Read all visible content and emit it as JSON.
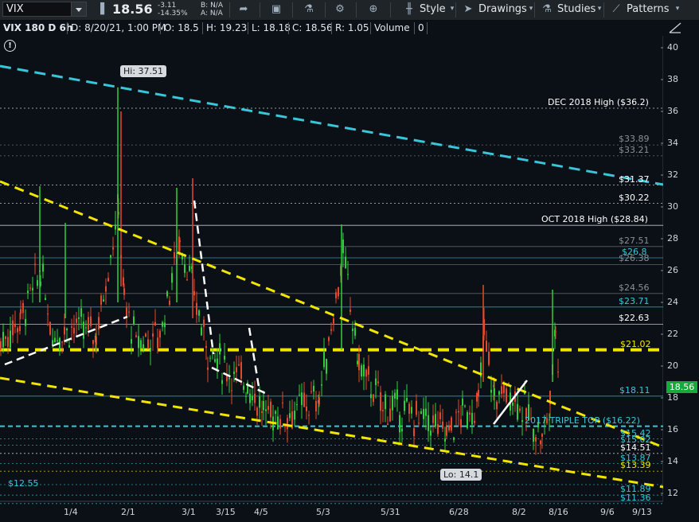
{
  "toolbar": {
    "symbol": "VIX",
    "last": "18.56",
    "change": "-3.11",
    "change_pct": "-14.35%",
    "bid": "B: N/A",
    "ask": "A: N/A",
    "style_label": "Style",
    "drawings_label": "Drawings",
    "studies_label": "Studies",
    "patterns_label": "Patterns"
  },
  "infobar": {
    "series": "VIX 180 D 6h",
    "date": "D: 8/20/21, 1:00 PM",
    "open": "O: 18.5",
    "high": "H: 19.23",
    "low": "L: 18.18",
    "close": "C: 18.56",
    "range": "R: 1.05",
    "volume_label": "Volume",
    "volume_value": "0"
  },
  "y_ticks": [
    "40",
    "38",
    "36",
    "34",
    "32",
    "30",
    "28",
    "26",
    "24",
    "22",
    "20",
    "18",
    "16",
    "14",
    "12"
  ],
  "x_ticks": [
    "1/4",
    "2/1",
    "3/1",
    "3/15",
    "4/5",
    "5/3",
    "5/31",
    "6/28",
    "8/2",
    "8/16",
    "9/6",
    "9/13"
  ],
  "levels": [
    {
      "text": "DEC 2018 High ($36.2)",
      "color": "#ffffff"
    },
    {
      "text": "$33.89",
      "color": "#8a9096"
    },
    {
      "text": "$33.21",
      "color": "#8a9096"
    },
    {
      "text": "$31.37",
      "color": "#ffffff"
    },
    {
      "text": "$30.22",
      "color": "#ffffff"
    },
    {
      "text": "OCT 2018 High ($28.84)",
      "color": "#ffffff"
    },
    {
      "text": "$27.51",
      "color": "#8a9096"
    },
    {
      "text": "$26.8",
      "color": "#39c6d8"
    },
    {
      "text": "$26.38",
      "color": "#8a9096"
    },
    {
      "text": "$24.56",
      "color": "#8a9096"
    },
    {
      "text": "$23.71",
      "color": "#39c6d8"
    },
    {
      "text": "$22.63",
      "color": "#ffffff"
    },
    {
      "text": "$21.02",
      "color": "#f2e600"
    },
    {
      "text": "$18.11",
      "color": "#39c6d8"
    },
    {
      "text": "2017  TRIPLE TOP  ($16.22)",
      "color": "#39c6d8"
    },
    {
      "text": "$15.42",
      "color": "#39c6d8"
    },
    {
      "text": "$15.02",
      "color": "#39c6d8"
    },
    {
      "text": "$14.51",
      "color": "#ffffff"
    },
    {
      "text": "$13.87",
      "color": "#39c6d8"
    },
    {
      "text": "$13.39",
      "color": "#f2e600"
    },
    {
      "text": "$12.55",
      "color": "#39c6d8"
    },
    {
      "text": "$11.89",
      "color": "#39c6d8"
    },
    {
      "text": "$11.36",
      "color": "#39c6d8"
    }
  ],
  "hi_label": "Hi: 37.51",
  "lo_label": "Lo: 14.1",
  "current_tag": "18.56",
  "colors": {
    "up": "#2fcf3a",
    "down": "#e24a2a",
    "cyan": "#39c6d8",
    "yellow": "#f2e600"
  }
}
